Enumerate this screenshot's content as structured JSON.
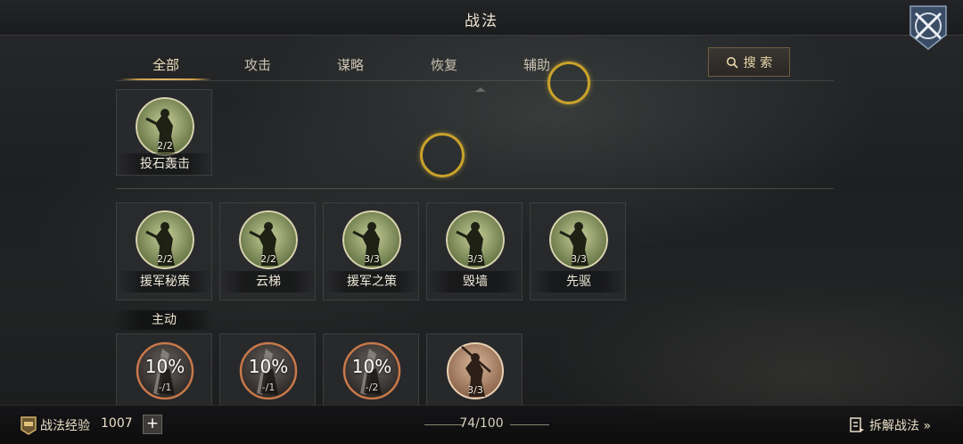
{
  "header": {
    "title": "战法"
  },
  "tabs": [
    {
      "label": "全部",
      "active": true
    },
    {
      "label": "攻击",
      "active": false
    },
    {
      "label": "谋略",
      "active": false
    },
    {
      "label": "恢复",
      "active": false
    },
    {
      "label": "辅助",
      "active": false
    }
  ],
  "search": {
    "label": "搜 索",
    "icon": "search-icon"
  },
  "top_row": [
    {
      "name": "投石轰击",
      "count": "2/2",
      "style": "green"
    }
  ],
  "middle_row": [
    {
      "name": "援军秘策",
      "count": "2/2",
      "style": "green"
    },
    {
      "name": "云梯",
      "count": "2/2",
      "style": "green"
    },
    {
      "name": "援军之策",
      "count": "3/3",
      "style": "green"
    },
    {
      "name": "毁墙",
      "count": "3/3",
      "style": "green"
    },
    {
      "name": "先驱",
      "count": "3/3",
      "style": "green"
    }
  ],
  "section": {
    "active_label": "主动"
  },
  "bottom_row": [
    {
      "percent": "10%",
      "sub": "-/1",
      "style": "orange"
    },
    {
      "percent": "10%",
      "sub": "-/1",
      "style": "orange"
    },
    {
      "percent": "10%",
      "sub": "-/2",
      "style": "orange"
    },
    {
      "count": "3/3",
      "style": "tan"
    }
  ],
  "footer": {
    "exp_label": "战法经验",
    "exp_value": "1007",
    "plus": "+",
    "capacity": "74/100",
    "decompose_label": "拆解战法 »"
  },
  "colors": {
    "accent_gold": "#c9a22a",
    "tab_active": "#f1e2bd",
    "icon_green": "#8d9a68",
    "icon_orange": "#c8784a"
  }
}
